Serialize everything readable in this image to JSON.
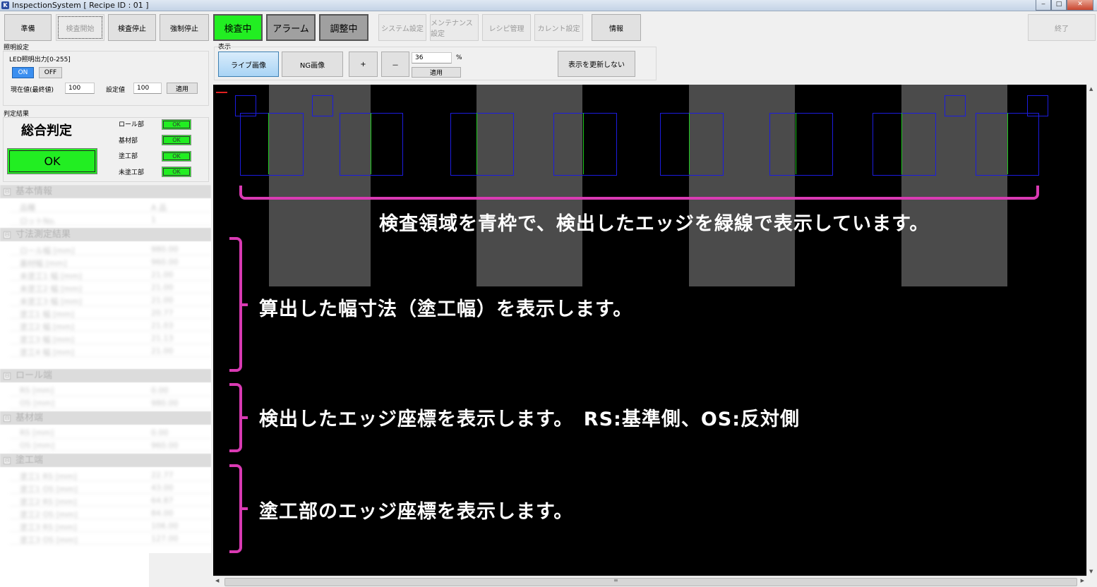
{
  "window": {
    "title": "InspectionSystem [ Recipe ID : 01 ]",
    "minimize": "‒",
    "maximize": "□",
    "close": "✕"
  },
  "toolbar": {
    "prepare": "準備",
    "start": "検査開始",
    "stop": "検査停止",
    "force_stop": "強制停止",
    "inspecting": "検査中",
    "alarm": "アラーム",
    "adjusting": "調整中",
    "system_settings": "システム設定",
    "maintenance_settings": "メンテナンス設定",
    "recipe_management": "レシピ管理",
    "current_settings": "カレント設定",
    "info": "情報",
    "exit": "終了"
  },
  "lighting": {
    "group_title": "照明設定",
    "led_label": "LED照明出力[0-255]",
    "on": "ON",
    "off": "OFF",
    "current_label": "現在値(最終値)",
    "current_value": "100",
    "setting_label": "設定値",
    "setting_value": "100",
    "apply": "適用"
  },
  "judgement": {
    "group_title": "判定結果",
    "overall_label": "総合判定",
    "overall_result": "OK",
    "overall_color": "#22ee22",
    "items": [
      {
        "label": "ロール部",
        "result": "OK"
      },
      {
        "label": "基材部",
        "result": "OK"
      },
      {
        "label": "塗工部",
        "result": "OK"
      },
      {
        "label": "未塗工部",
        "result": "OK"
      }
    ]
  },
  "display": {
    "group_title": "表示",
    "live_image": "ライブ画像",
    "ng_image": "NG画像",
    "zoom_in": "+",
    "zoom_out": "－",
    "zoom_value": "36",
    "zoom_unit": "%",
    "apply": "適用",
    "no_refresh": "表示を更新しない"
  },
  "tree": {
    "categories": [
      {
        "label": "基本情報",
        "toggle": "⊟",
        "rows": [
          {
            "k": "品種",
            "v": "A 品"
          },
          {
            "k": "ロットNo.",
            "v": "1"
          }
        ]
      },
      {
        "label": "寸法測定結果",
        "toggle": "⊟",
        "rows": [
          {
            "k": "ロール幅 [mm]",
            "v": "980.00"
          },
          {
            "k": "基材幅 [mm]",
            "v": "960.00"
          },
          {
            "k": "未塗工1 幅 [mm]",
            "v": "21.00"
          },
          {
            "k": "未塗工2 幅 [mm]",
            "v": "21.00"
          },
          {
            "k": "未塗工3 幅 [mm]",
            "v": "21.00"
          },
          {
            "k": "塗工1 幅 [mm]",
            "v": "20.77"
          },
          {
            "k": "塗工2 幅 [mm]",
            "v": "21.03"
          },
          {
            "k": "塗工3 幅 [mm]",
            "v": "21.13"
          },
          {
            "k": "塗工4 幅 [mm]",
            "v": "21.00"
          }
        ]
      },
      {
        "label": "ロール端",
        "toggle": "⊟",
        "rows": [
          {
            "k": "RS [mm]",
            "v": "0.00"
          },
          {
            "k": "OS [mm]",
            "v": "980.00"
          }
        ]
      },
      {
        "label": "基材端",
        "toggle": "⊟",
        "rows": [
          {
            "k": "RS [mm]",
            "v": "0.00"
          },
          {
            "k": "OS [mm]",
            "v": "960.00"
          }
        ]
      },
      {
        "label": "塗工端",
        "toggle": "⊟",
        "rows": [
          {
            "k": "塗工1 RS [mm]",
            "v": "22.77"
          },
          {
            "k": "塗工1 OS [mm]",
            "v": "43.00"
          },
          {
            "k": "塗工2 RS [mm]",
            "v": "64.87"
          },
          {
            "k": "塗工2 OS [mm]",
            "v": "84.00"
          },
          {
            "k": "塗工3 RS [mm]",
            "v": "106.00"
          },
          {
            "k": "塗工3 OS [mm]",
            "v": "127.00"
          }
        ]
      }
    ]
  },
  "annotations": {
    "roi": "検査領域を青枠で、検出したエッジを緑線で表示しています。",
    "width": "算出した幅寸法（塗工幅）を表示します。",
    "edge": "検出したエッジ座標を表示します。　RS:基準側、OS:反対側",
    "coat": "塗工部のエッジ座標を表示します。"
  },
  "colors": {
    "roi_frame": "#1c1ce0",
    "edge_line": "#1ec81e",
    "brace": "#d93ab3",
    "ok_green": "#22ee22"
  },
  "scroll": {
    "up": "▲",
    "down": "▼",
    "left": "◀",
    "right": "▶",
    "grip": "≡"
  }
}
